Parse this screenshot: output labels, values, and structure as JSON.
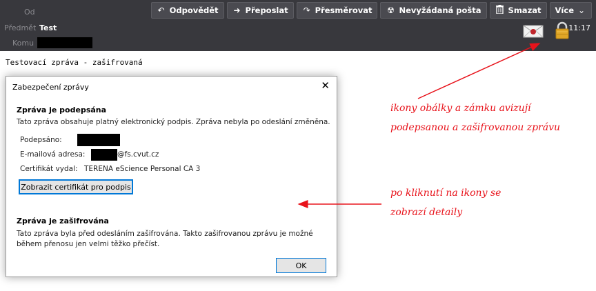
{
  "header": {
    "from_label": "Od",
    "subject_label": "Předmět",
    "subject_value": "Test",
    "to_label": "Komu",
    "time": "11:17",
    "toolbar": [
      {
        "label": "Odpovědět",
        "icon": "reply-icon"
      },
      {
        "label": "Přeposlat",
        "icon": "forward-icon"
      },
      {
        "label": "Přesměrovat",
        "icon": "redirect-icon"
      },
      {
        "label": "Nevyžádaná pošta",
        "icon": "junk-icon"
      },
      {
        "label": "Smazat",
        "icon": "trash-icon"
      },
      {
        "label": "Více",
        "icon": "chevron-down-icon"
      }
    ],
    "status_icons": [
      "signed-envelope-icon",
      "encrypted-lock-icon"
    ]
  },
  "body": {
    "text": "Testovací zpráva - zašifrovaná"
  },
  "dialog": {
    "title": "Zabezpečení zprávy",
    "signed_heading": "Zpráva je podepsána",
    "signed_text": "Tato zpráva obsahuje platný elektronický podpis. Zpráva nebyla po odeslání změněna.",
    "signed_by_label": "Podepsáno:",
    "email_label": "E-mailová adresa:",
    "email_suffix": "@fs.cvut.cz",
    "issuer_label": "Certifikát vydal:",
    "issuer_value": "TERENA eScience Personal CA 3",
    "view_cert_button": "Zobrazit certifikát pro podpis",
    "encrypted_heading": "Zpráva je zašifrována",
    "encrypted_text_1": "Tato zpráva byla před odesláním zašifrována. Takto zašifrovanou zprávu je možné",
    "encrypted_text_2": "během přenosu jen velmi těžko přečíst.",
    "ok_button": "OK"
  },
  "annotations": {
    "note1_line1": "ikony obálky a zámku avizují",
    "note1_line2": "podepsanou a zašifrovanou zprávu",
    "note2_line1": "po kliknutí na ikony se",
    "note2_line2": "zobrazí detaily",
    "color": "#e8131b"
  }
}
